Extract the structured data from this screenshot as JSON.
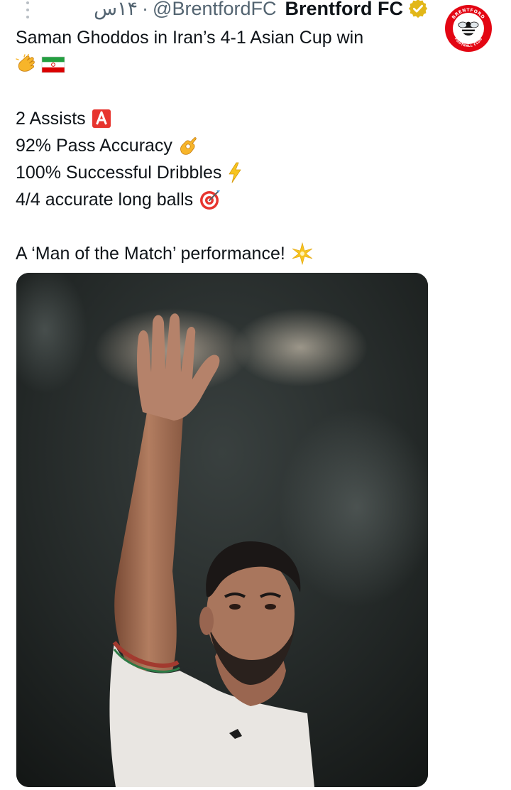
{
  "tweet": {
    "timestamp": "۱۴س",
    "separator": "·",
    "handle": "@BrentfordFC",
    "display_name": "Brentford FC",
    "verified": true,
    "text_lines": [
      "Saman Ghoddos in Iran’s 4-1 Asian Cup win",
      "",
      "",
      "2 Assists",
      "92% Pass Accuracy",
      "100% Successful Dribbles",
      "4/4 accurate long balls",
      "",
      "A ‘Man of the Match’ performance!"
    ],
    "avatar_text_top": "BRENTFORD",
    "avatar_text_bottom": "FOOTBALL CLUB",
    "icons": {
      "clap": "clapping-hands-icon",
      "flag": "iran-flag-icon",
      "assists": "letter-a-icon",
      "pass": "ok-hand-icon",
      "dribbles": "lightning-icon",
      "longballs": "target-icon",
      "motm": "sparkle-icon"
    },
    "colors": {
      "verified_badge": "#e2b719",
      "text": "#0f1419",
      "muted": "#536471",
      "brentford_red": "#e30613"
    }
  }
}
